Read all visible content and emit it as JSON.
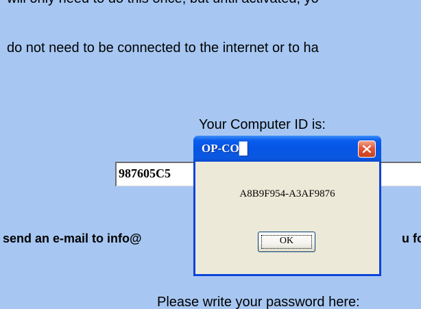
{
  "page": {
    "line_cut": "will only need to do this once, but until activated, yo",
    "line_internet": "do not need to be connected to the internet or to ha",
    "computer_id_label": "Your Computer ID is:",
    "computer_id_value": "987605C5",
    "send_email_left": "send an e-mail to info@",
    "send_email_right": "u for",
    "password_label": "Please write your password here:"
  },
  "dialog": {
    "title": "OP-CO█",
    "message": "A8B9F954-A3AF9876",
    "ok_label": "OK",
    "close_icon": "close-x-icon"
  },
  "colors": {
    "page_background": "#a7c7f2",
    "titlebar": "#0655e4",
    "dialog_client": "#ece9d8",
    "close_button": "#e1583a"
  }
}
